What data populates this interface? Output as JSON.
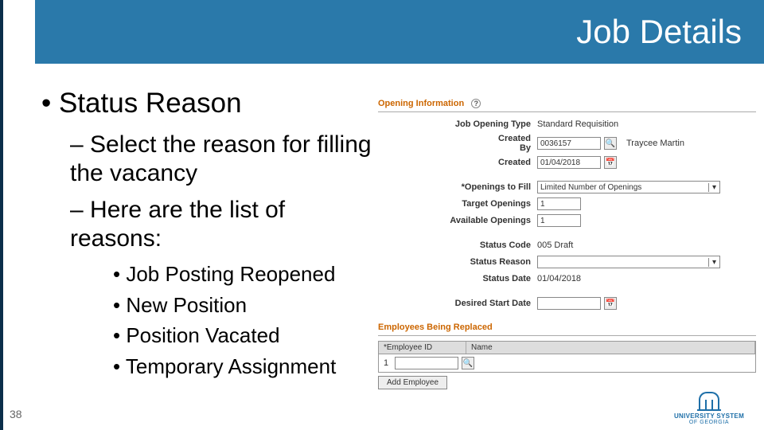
{
  "header": {
    "title": "Job Details"
  },
  "footer": {
    "page_number": "38"
  },
  "content": {
    "heading": "Status Reason",
    "sub1": "Select the reason for filling the vacancy",
    "sub2": "Here are the list of reasons:",
    "reasons": [
      "Job Posting Reopened",
      "New Position",
      "Position Vacated",
      "Temporary Assignment"
    ]
  },
  "form": {
    "section1_title": "Opening Information",
    "labels": {
      "job_opening_type": "Job Opening Type",
      "created_by": "Created By",
      "created": "Created",
      "openings_to_fill": "*Openings to Fill",
      "target_openings": "Target Openings",
      "available_openings": "Available Openings",
      "status_code": "Status Code",
      "status_reason": "Status Reason",
      "status_date": "Status Date",
      "desired_start_date": "Desired Start Date"
    },
    "values": {
      "job_opening_type": "Standard Requisition",
      "created_by_id": "0036157",
      "created_by_name": "Traycee Martin",
      "created_date": "01/04/2018",
      "openings_to_fill": "Limited Number of Openings",
      "target_openings": "1",
      "available_openings": "1",
      "status_code": "005 Draft",
      "status_reason": "",
      "status_date": "01/04/2018",
      "desired_start_date": ""
    },
    "section2_title": "Employees Being Replaced",
    "grid": {
      "col_a": "*Employee ID",
      "col_b": "Name",
      "row_index": "1",
      "row_value": ""
    },
    "add_button": "Add Employee"
  },
  "logo": {
    "line1": "UNIVERSITY SYSTEM",
    "line2": "OF GEORGIA"
  }
}
